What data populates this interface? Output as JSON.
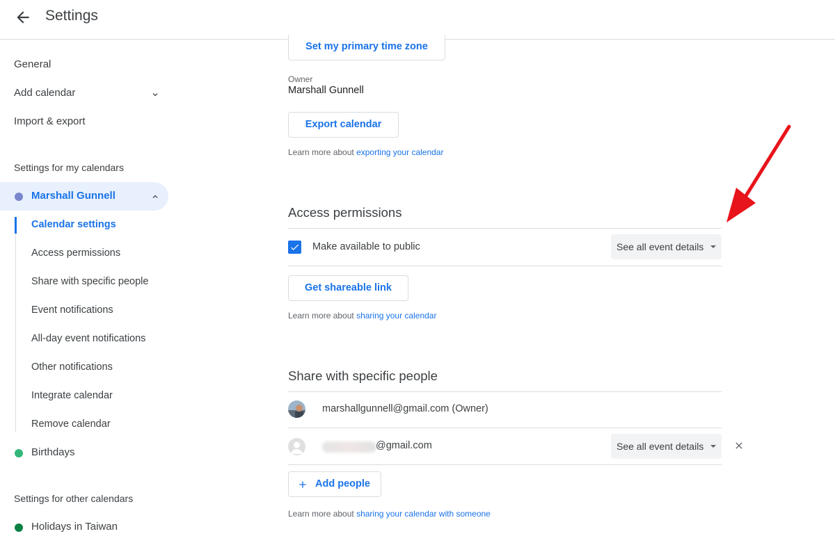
{
  "header": {
    "title": "Settings"
  },
  "sidebar": {
    "nav": [
      {
        "label": "General"
      },
      {
        "label": "Add calendar"
      },
      {
        "label": "Import & export"
      }
    ],
    "my_calendars_label": "Settings for my calendars",
    "my_calendars": [
      {
        "label": "Marshall Gunnell",
        "color": "#7986cb"
      },
      {
        "label": "Birthdays",
        "color": "#33b679"
      }
    ],
    "subnav": [
      {
        "label": "Calendar settings"
      },
      {
        "label": "Access permissions"
      },
      {
        "label": "Share with specific people"
      },
      {
        "label": "Event notifications"
      },
      {
        "label": "All-day event notifications"
      },
      {
        "label": "Other notifications"
      },
      {
        "label": "Integrate calendar"
      },
      {
        "label": "Remove calendar"
      }
    ],
    "other_calendars_label": "Settings for other calendars",
    "other_calendars": [
      {
        "label": "Holidays in Taiwan",
        "color": "#0b8043"
      }
    ]
  },
  "main": {
    "timezone_button": "Set my primary time zone",
    "owner_label": "Owner",
    "owner_name": "Marshall Gunnell",
    "export_button": "Export calendar",
    "export_learn": {
      "prefix": "Learn more about ",
      "link": "exporting your calendar"
    },
    "access": {
      "title": "Access permissions",
      "public_checkbox_label": "Make available to public",
      "public_checked": true,
      "visibility_option": "See all event details",
      "link_button": "Get shareable link",
      "learn": {
        "prefix": "Learn more about ",
        "link": "sharing your calendar"
      }
    },
    "share": {
      "title": "Share with specific people",
      "people": [
        {
          "email": "marshallgunnell@gmail.com (Owner)"
        },
        {
          "email": "@gmail.com",
          "permission": "See all event details"
        }
      ],
      "add_button": "Add people",
      "learn": {
        "prefix": "Learn more about ",
        "link": "sharing your calendar with someone"
      }
    }
  },
  "colors": {
    "accent": "#1a73e8",
    "annotation": "#e8141b"
  }
}
